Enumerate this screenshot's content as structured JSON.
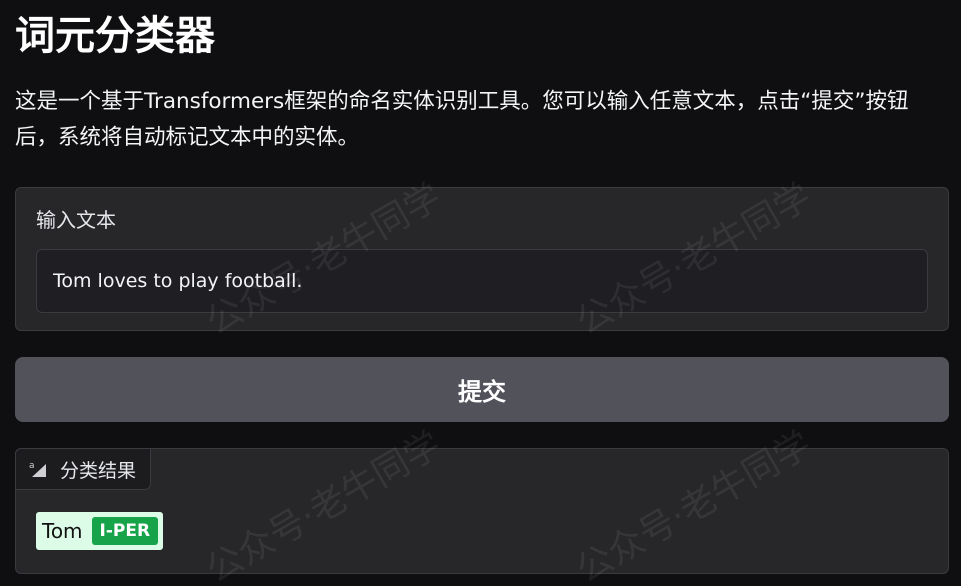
{
  "app": {
    "title": "词元分类器",
    "description": "这是一个基于Transformers框架的命名实体识别工具。您可以输入任意文本，点击“提交”按钮后，系统将自动标记文本中的实体。"
  },
  "input": {
    "label": "输入文本",
    "value": "Tom loves to play football."
  },
  "submit": {
    "label": "提交"
  },
  "result": {
    "tab_label": "分类结果",
    "tab_icon": "text-highlight-icon",
    "entities": [
      {
        "text": "Tom",
        "label": "I-PER"
      }
    ]
  },
  "watermark": {
    "text": "公众号·老牛同学"
  },
  "colors": {
    "background": "#0f0f11",
    "panel": "#27272a",
    "button": "#52525b",
    "entity_bg": "#dcfce7",
    "entity_label": "#16a34a"
  }
}
